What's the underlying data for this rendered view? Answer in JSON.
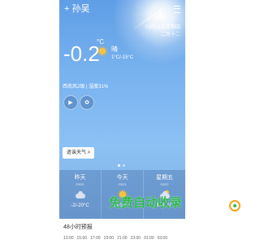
{
  "header": {
    "city": "+ 孙吴"
  },
  "date": {
    "solar": "03月21日星期四",
    "lunar": "二月十二"
  },
  "current": {
    "temp": "-0.2",
    "unit": "°C",
    "condition": "晴",
    "range": "1°C/-15°C",
    "wind_humidity": "西南风2级 | 湿度31%"
  },
  "buttons": {
    "forecast": "逐诶天气 >"
  },
  "days": [
    {
      "name": "昨天",
      "date": "03/20",
      "icon": "cloud-icon",
      "range": "-2/-20°C"
    },
    {
      "name": "今天",
      "date": "03/21",
      "icon": "sun-icon",
      "range": "1/-15°C"
    },
    {
      "name": "星期五",
      "date": "03/22",
      "icon": "partly-cloudy-icon",
      "range": "4/-12°C"
    }
  ],
  "hourly": {
    "title": "48小时预报",
    "hours": [
      "13:00",
      "15:00",
      "17:00",
      "19:00",
      "21:00",
      "23:00",
      "01:00",
      "03:00"
    ]
  },
  "watermark": {
    "text": "免费自动收录"
  },
  "colors": {
    "sky_top": "#5f9ee6",
    "sky_mid": "#8cc1f4",
    "sun": "#f8c33a",
    "watermark": "#2fb84e"
  }
}
